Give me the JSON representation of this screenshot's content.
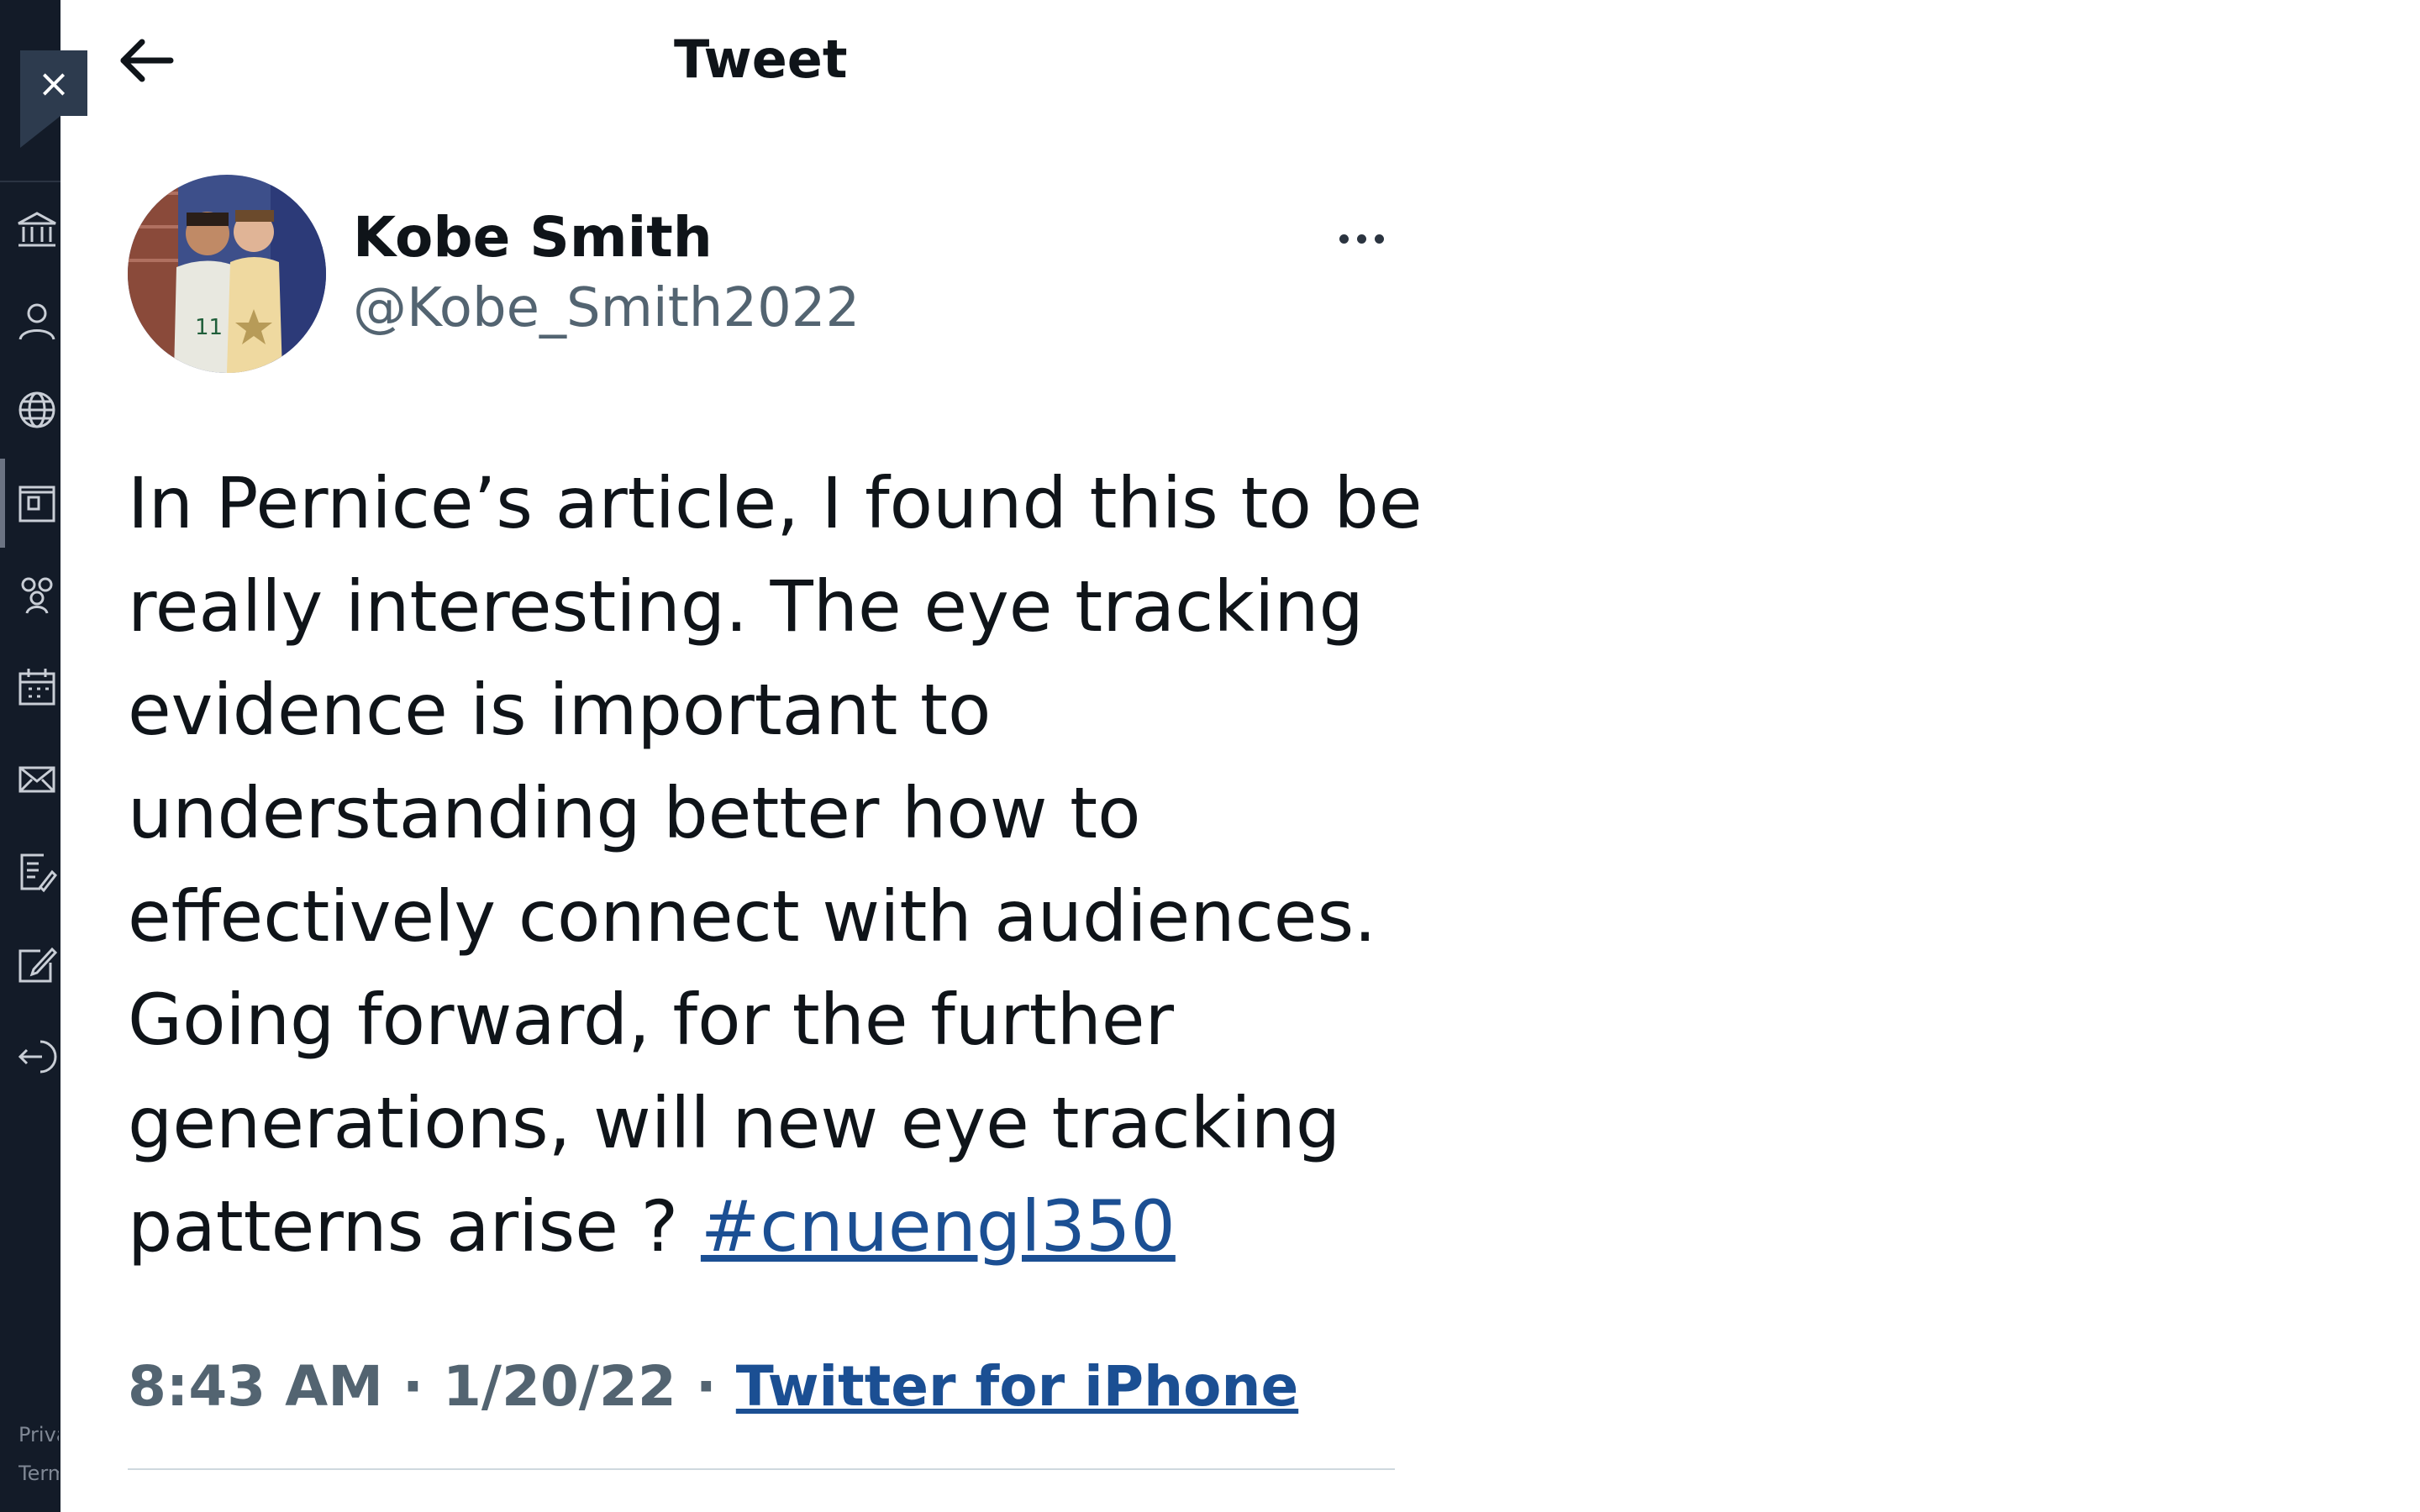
{
  "lms_nav": {
    "close_label": "×",
    "icons": [
      "institution-icon",
      "account-icon",
      "globe-icon",
      "courses-icon",
      "groups-icon",
      "calendar-icon",
      "inbox-icon",
      "history-icon",
      "commons-icon",
      "logout-icon"
    ],
    "footer_privacy": "Priva",
    "footer_terms": "Term"
  },
  "header": {
    "title": "Tweet",
    "back_icon": "arrow-left-icon"
  },
  "tweet": {
    "author_name": "Kobe Smith",
    "author_handle": "@Kobe_Smith2022",
    "body_text": "In Pernice’s article, I found this to be really interesting. The eye tracking evidence is important to understanding better how to effectively connect with audiences. Going forward, for the further generations, will new eye tracking patterns arise ? ",
    "hashtag": "#cnuengl350",
    "time": "8:43 AM",
    "date": "1/20/22",
    "separator": " · ",
    "source": "Twitter for iPhone"
  },
  "colors": {
    "nav_bg": "#131b28",
    "link": "#1b4f93",
    "muted": "#536471"
  }
}
